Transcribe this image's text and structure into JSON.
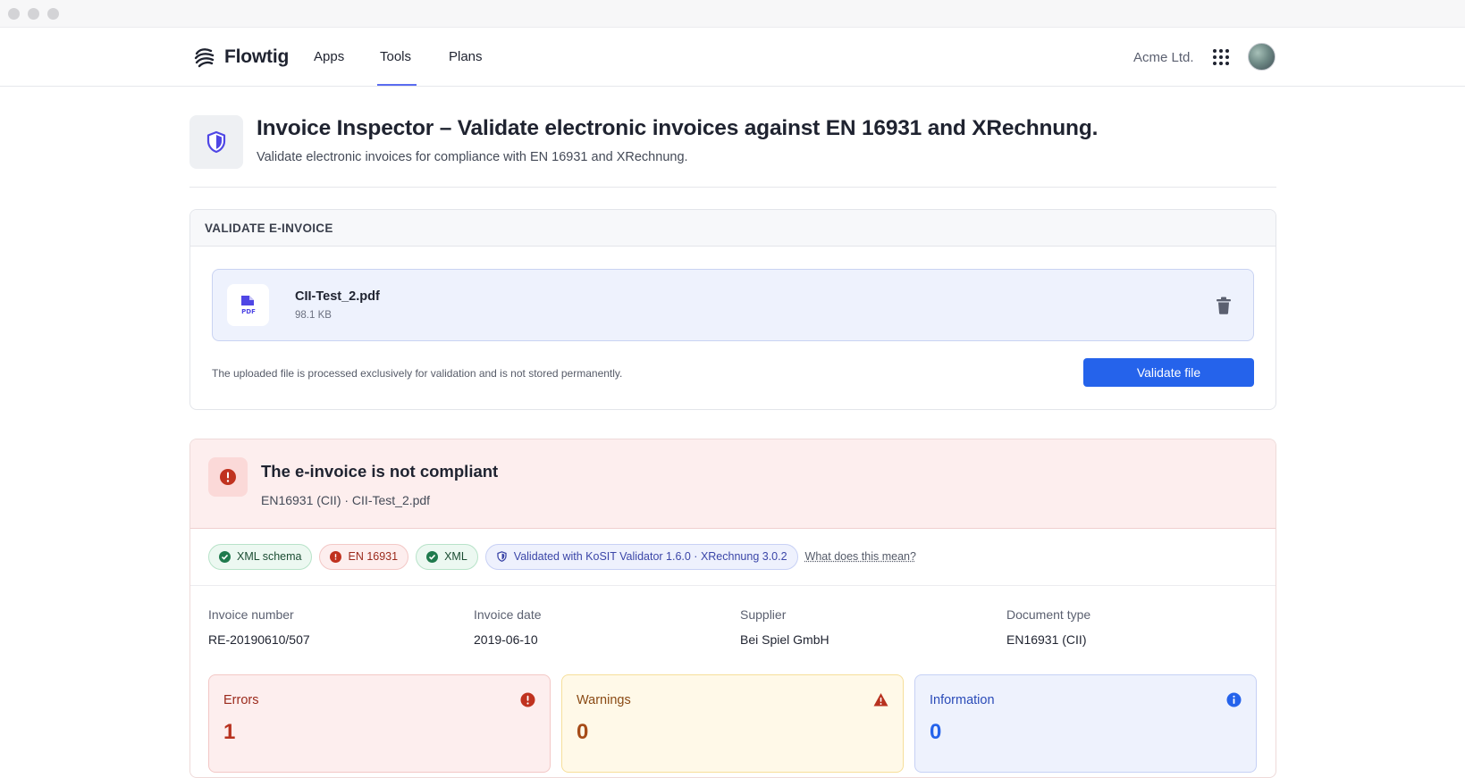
{
  "nav": {
    "brand": "Flowtig",
    "items": [
      {
        "label": "Apps"
      },
      {
        "label": "Tools"
      },
      {
        "label": "Plans"
      }
    ],
    "active": "Tools",
    "organization": "Acme Ltd."
  },
  "header": {
    "title": "Invoice Inspector – Validate electronic invoices against EN 16931 and XRechnung.",
    "subtitle": "Validate electronic invoices for compliance with EN 16931 and XRechnung.",
    "icon": "shield-icon"
  },
  "upload": {
    "section_title": "VALIDATE E-INVOICE",
    "file_name": "CII-Test_2.pdf",
    "file_size": "98.1 KB",
    "file_icon_label": "PDF",
    "note": "The uploaded file is processed exclusively for validation and is not stored permanently.",
    "validate_label": "Validate file"
  },
  "result": {
    "title": "The e-invoice is not compliant",
    "subtitle": "EN16931 (CII) · CII-Test_2.pdf",
    "chips": [
      {
        "label": "XML schema",
        "status": "ok"
      },
      {
        "label": "EN 16931",
        "status": "error"
      },
      {
        "label": "XML",
        "status": "ok"
      },
      {
        "label": "Validated with KoSIT Validator 1.6.0 · XRechnung 3.0.2",
        "status": "info"
      }
    ],
    "help_link": "What does this mean?",
    "meta": [
      {
        "label": "Invoice number",
        "value": "RE-20190610/507"
      },
      {
        "label": "Invoice date",
        "value": "2019-06-10"
      },
      {
        "label": "Supplier",
        "value": "Bei Spiel GmbH"
      },
      {
        "label": "Document type",
        "value": "EN16931 (CII)"
      }
    ],
    "stats": {
      "errors": {
        "label": "Errors",
        "value": "1"
      },
      "warnings": {
        "label": "Warnings",
        "value": "0"
      },
      "information": {
        "label": "Information",
        "value": "0"
      }
    }
  },
  "colors": {
    "accent": "#2563eb",
    "nav_active": "#5b6cf0",
    "error": "#b8321f",
    "warning": "#a64b17",
    "ok": "#1f7a4d",
    "info": "#3b46a8"
  }
}
